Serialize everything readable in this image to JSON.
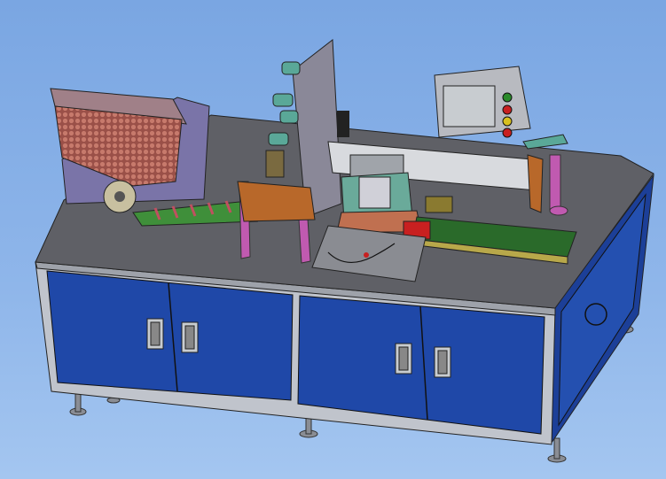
{
  "scene": {
    "colors": {
      "background": "#86afe6",
      "tabletop": "#5f6066",
      "panel_blue": "#1f48a8",
      "frame": "#b8bcc4",
      "hopper_red": "#b0584e",
      "conveyor_green": "#3f8f3a",
      "accent_pink": "#c05ab0",
      "screen": "#c8ccd0"
    },
    "icons": [
      "door-handle-icon",
      "indicator-light-icon"
    ]
  }
}
